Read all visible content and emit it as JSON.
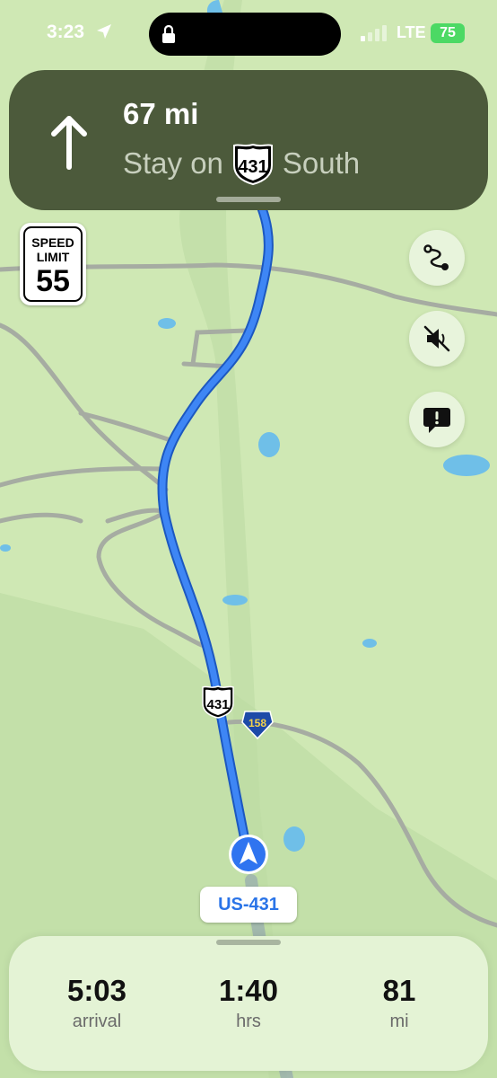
{
  "status_bar": {
    "time": "3:23",
    "network": "LTE",
    "battery": "75"
  },
  "guidance": {
    "distance": "67 mi",
    "instruction_prefix": "Stay on",
    "route_shield": "431",
    "direction": "South"
  },
  "speed_limit": {
    "label_line1": "SPEED",
    "label_line2": "LIMIT",
    "value": "55"
  },
  "map": {
    "us_shield": "431",
    "state_shield": "158",
    "current_road": "US-431"
  },
  "trip": {
    "arrival_time": "5:03",
    "arrival_label": "arrival",
    "duration": "1:40",
    "duration_label": "hrs",
    "distance": "81",
    "distance_label": "mi"
  },
  "icons": {
    "direction": "arrow-up-icon",
    "route_overview": "route-icon",
    "audio": "speaker-muted-icon",
    "report": "report-alert-icon",
    "location": "location-arrow-icon",
    "lock": "lock-icon",
    "user_location": "navigation-arrow-icon"
  },
  "colors": {
    "banner": "#4c5a3b",
    "route": "#2f74f0",
    "map_land": "#cfe8b4",
    "water": "#6fbfe8",
    "tray": "#e4f3d5"
  }
}
